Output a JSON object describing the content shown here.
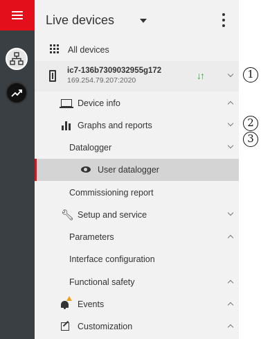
{
  "header": {
    "title": "Live devices"
  },
  "all_devices": {
    "label": "All devices"
  },
  "device": {
    "name": "ic7-136b7309032955g172",
    "ip": "169.254.79.207:2020"
  },
  "menu": {
    "device_info": "Device info",
    "graphs": "Graphs and reports",
    "datalogger": "Datalogger",
    "user_datalogger": "User datalogger",
    "commissioning": "Commissioning report",
    "setup": "Setup and service",
    "parameters": "Parameters",
    "interface": "Interface configuration",
    "functional_safety": "Functional safety",
    "events": "Events",
    "customization": "Customization"
  },
  "callouts": [
    "1",
    "2",
    "3"
  ],
  "colors": {
    "brand_red": "#e3101b",
    "status_green": "#2eaa3a",
    "rail": "#3a3f44",
    "warning": "#f0a020"
  }
}
